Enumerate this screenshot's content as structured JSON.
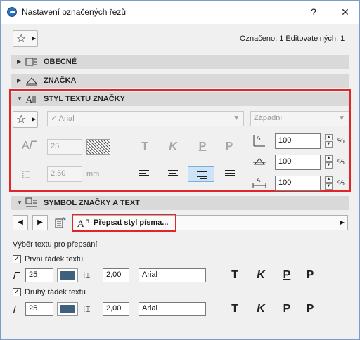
{
  "window": {
    "title": "Nastavení označených řezů",
    "help": "?",
    "close": "✕"
  },
  "status": {
    "text": "Označeno: 1 Editovatelných: 1"
  },
  "sections": {
    "general": "OBECNÉ",
    "marker": "ZNAČKA",
    "text_style": "STYL TEXTU ZNAČKY",
    "symbol": "SYMBOL ZNAČKY A TEXT"
  },
  "text_style": {
    "font": "Arial",
    "encoding": "Západní",
    "font_size": "25",
    "leading": "2,50",
    "leading_unit": "mm",
    "style_buttons": [
      "T",
      "K",
      "P",
      "P"
    ],
    "width_pct": "100",
    "height_pct": "100",
    "spacing_pct": "100",
    "pct_unit": "%"
  },
  "override": {
    "label": "Přepsat styl písma..."
  },
  "overwrite": {
    "title": "Výběr textu pro přepsání",
    "row1": {
      "label": "První řádek textu",
      "size": "25",
      "leading": "2,00",
      "font": "Arial",
      "checked": true
    },
    "row2": {
      "label": "Druhý řádek textu",
      "size": "25",
      "leading": "2,00",
      "font": "Arial",
      "checked": true
    },
    "style_buttons": [
      "T",
      "K",
      "P",
      "P"
    ]
  },
  "colors": {
    "highlight": "#e0262b",
    "selected": "#cde3f7",
    "pen": "#3e5f7d"
  }
}
